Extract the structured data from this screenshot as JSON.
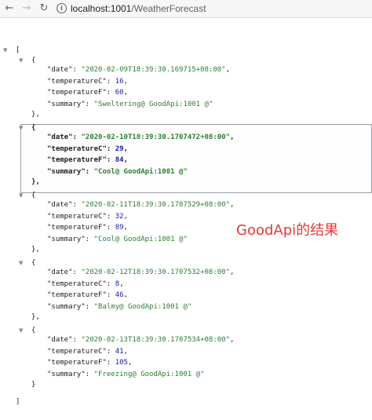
{
  "browser": {
    "url_host": "localhost:1001",
    "url_path": "/WeatherForecast"
  },
  "json_view": {
    "open_bracket": "[",
    "close_bracket": "]",
    "open_brace": "{",
    "close_brace": "}",
    "close_brace_comma": "},",
    "records": [
      {
        "date": "2020-02-09T18:39:30.169715+08:00",
        "temperatureC": "16",
        "temperatureF": "60",
        "summary": "Sweltering@ GoodApi:1001 @"
      },
      {
        "date": "2020-02-10T18:39:30.1707472+08:00",
        "temperatureC": "29",
        "temperatureF": "84",
        "summary": "Cool@ GoodApi:1001 @"
      },
      {
        "date": "2020-02-11T18:39:30.1707529+08:00",
        "temperatureC": "32",
        "temperatureF": "89",
        "summary": "Cool@ GoodApi:1001 @"
      },
      {
        "date": "2020-02-12T18:39:30.1707532+08:00",
        "temperatureC": "8",
        "temperatureF": "46",
        "summary": "Balmy@ GoodApi:1001 @"
      },
      {
        "date": "2020-02-13T18:39:30.1707534+08:00",
        "temperatureC": "41",
        "temperatureF": "105",
        "summary": "Freezing@ GoodApi:1001 @"
      }
    ],
    "keys": {
      "date": "\"date\": ",
      "temperatureC": "\"temperatureC\": ",
      "temperatureF": "\"temperatureF\": ",
      "summary": "\"summary\": "
    }
  },
  "annotation": "GoodApi的结果"
}
